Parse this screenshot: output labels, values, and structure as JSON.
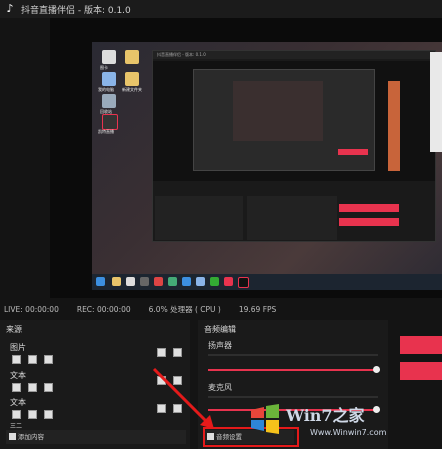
{
  "window": {
    "title": "抖音直播伴侣 - 版本: 0.1.0"
  },
  "preview": {
    "desktop_icons": [
      {
        "label": "图卡"
      },
      {
        "label": "我的电脑"
      },
      {
        "label": "新建文件夹"
      },
      {
        "label": "回收站"
      },
      {
        "label": "凯特直播"
      }
    ],
    "inner_title": "抖音直播伴侣 - 版本: 0.1.0"
  },
  "status": {
    "live": "LIVE: 00:00:00",
    "rec": "REC: 00:00:00",
    "cpu": "6.0% 处理器 ( CPU )",
    "fps": "19.69 FPS"
  },
  "sources": {
    "header": "来源",
    "items": [
      {
        "label": "图片"
      },
      {
        "label": "文本"
      },
      {
        "label": "文本"
      },
      {
        "label": "三二"
      }
    ],
    "add_label": "添加内容"
  },
  "audio": {
    "header": "音频编辑",
    "speaker_label": "扬声器",
    "mic_label": "麦克风",
    "settings_label": "音频设置",
    "speaker_level": 0.98,
    "mic_level": 0.98
  },
  "watermark": {
    "brand": "Win7之家",
    "url": "Www.Winwin7.com"
  },
  "colors": {
    "accent": "#e8334e",
    "highlight": "#e41a1a"
  }
}
